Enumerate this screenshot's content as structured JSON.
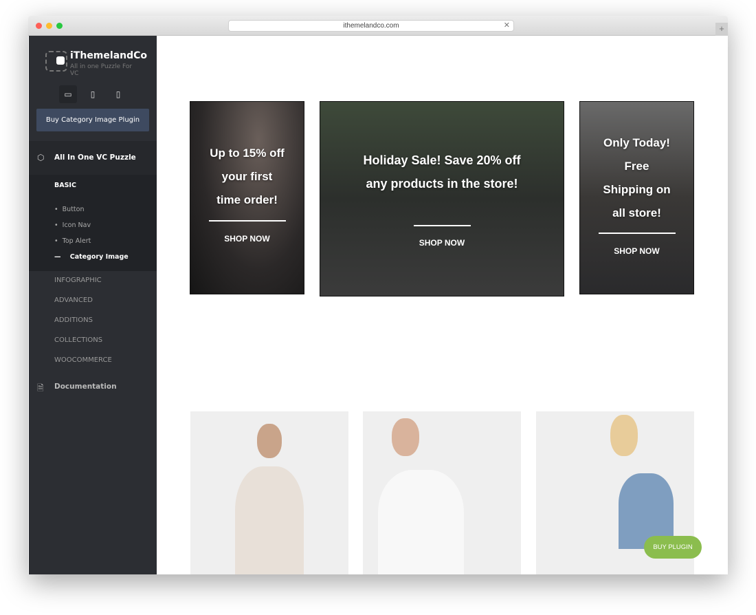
{
  "browser": {
    "url": "ithemelandco.com",
    "colors": {
      "close": "#fe5f57",
      "min": "#febc2e",
      "max": "#28c840"
    }
  },
  "sidebar": {
    "logo_title": "iThemelandCo",
    "logo_subtitle": "All in one Puzzle For VC",
    "devices": [
      "desktop-icon",
      "tablet-icon",
      "mobile-icon"
    ],
    "buy_button": "Buy Category Image Plugin",
    "section": "All In One VC Puzzle",
    "basic_label": "BASIC",
    "basic_items": [
      "Button",
      "Icon Nav",
      "Top Alert",
      "Category Image"
    ],
    "categories": [
      "INFOGRAPHIC",
      "ADVANCED",
      "ADDITIONS",
      "COLLECTIONS",
      "WOOCOMMERCE"
    ],
    "documentation": "Documentation"
  },
  "banners": [
    {
      "lines": [
        "Up to 15% off",
        "your first",
        "time order!"
      ],
      "cta": "SHOP NOW"
    },
    {
      "lines": [
        "Holiday Sale! Save 20% off",
        "any products in the store!"
      ],
      "cta": "SHOP NOW"
    },
    {
      "lines": [
        "Only Today!",
        "Free",
        "Shipping on",
        "all store!"
      ],
      "cta": "SHOP NOW"
    }
  ],
  "floating_button": "BUY PLUGIN"
}
